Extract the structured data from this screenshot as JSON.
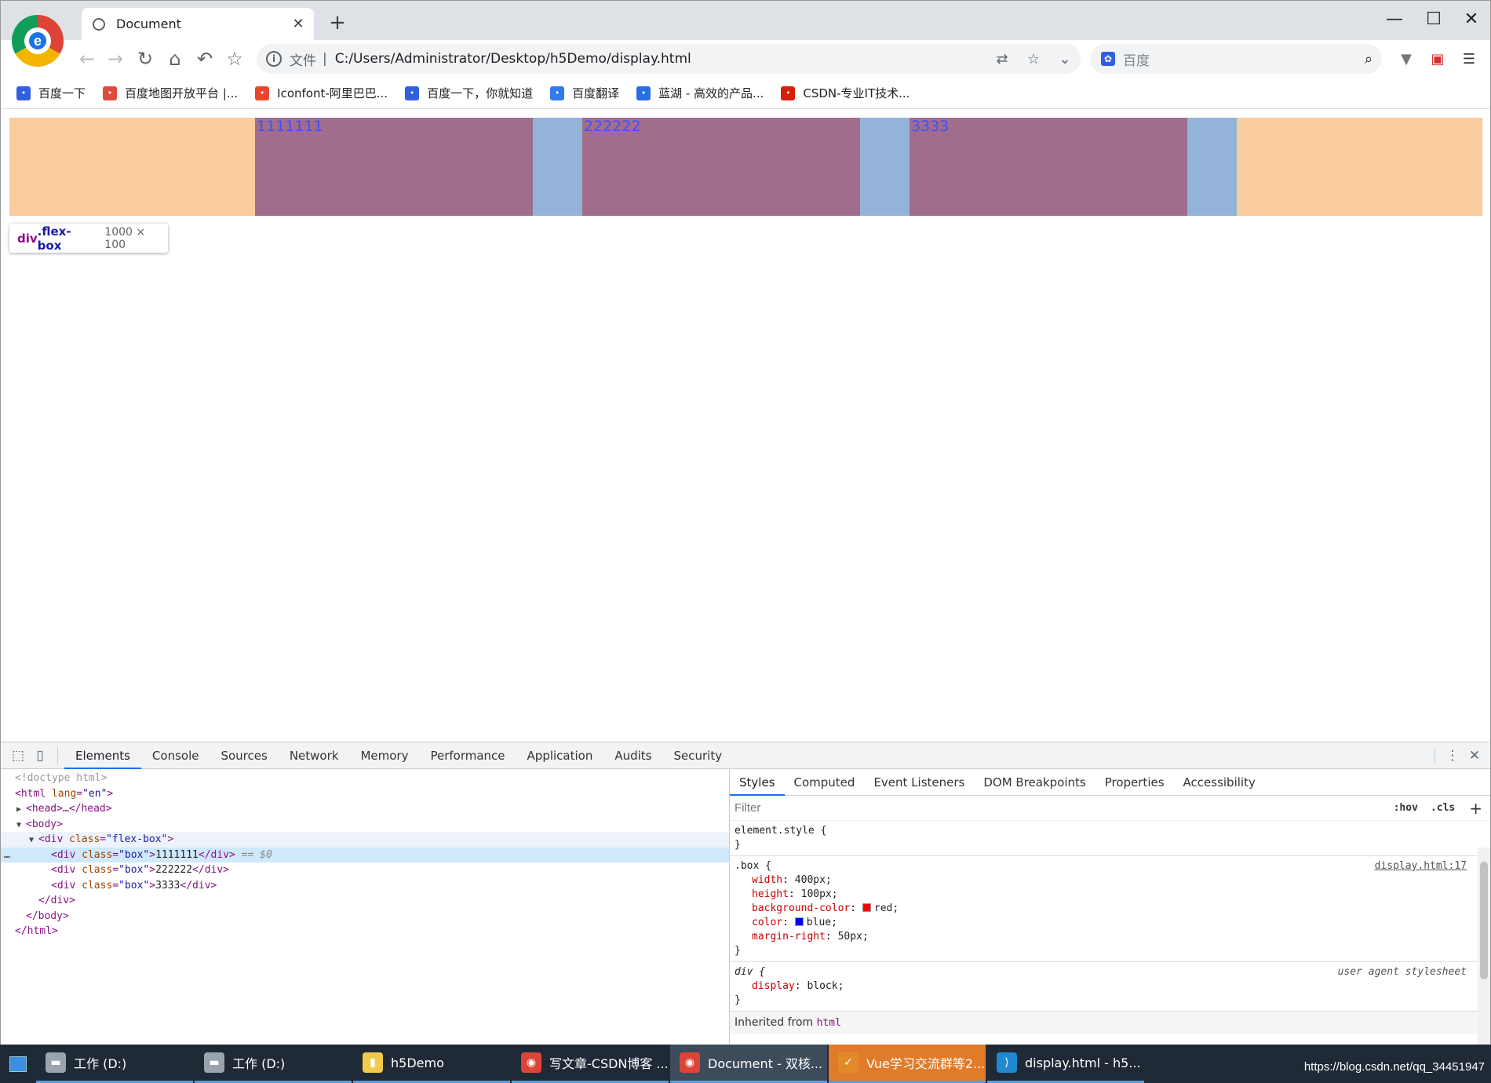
{
  "browser": {
    "tab_title": "Document",
    "omnibox_label": "文件",
    "omnibox_separator": "|",
    "url": "C:/Users/Administrator/Desktop/h5Demo/display.html",
    "search_placeholder": "百度"
  },
  "bookmarks": [
    {
      "label": "百度一下",
      "icon": "baidu-paw-icon",
      "color": "#3060e0"
    },
    {
      "label": "百度地图开放平台 |...",
      "icon": "map-pin-icon",
      "color": "#e04a3f"
    },
    {
      "label": "Iconfont-阿里巴巴...",
      "icon": "iconfont-icon",
      "color": "#e9462b"
    },
    {
      "label": "百度一下，你就知道",
      "icon": "baidu-paw-icon",
      "color": "#3060e0"
    },
    {
      "label": "百度翻译",
      "icon": "translate-icon",
      "color": "#2f7ce8"
    },
    {
      "label": "蓝湖 - 高效的产品...",
      "icon": "lanhu-icon",
      "color": "#2b6de6"
    },
    {
      "label": "CSDN-专业IT技术...",
      "icon": "csdn-icon",
      "color": "#d81e06"
    }
  ],
  "page": {
    "boxes": [
      "1111111",
      "222222",
      "3333"
    ],
    "tooltip": {
      "tag": "div",
      "class": ".flex-box",
      "size": "1000 × 100"
    }
  },
  "devtools": {
    "tabs": [
      "Elements",
      "Console",
      "Sources",
      "Network",
      "Memory",
      "Performance",
      "Application",
      "Audits",
      "Security"
    ],
    "active_tab": "Elements",
    "dom": {
      "doctype": "<!doctype html>",
      "html_open_tag": "html",
      "html_lang_attr": "lang",
      "html_lang_val": "\"en\"",
      "head_collapsed": "<head>…</head>",
      "body_open": "<body>",
      "flexbox_class": "\"flex-box\"",
      "box_class": "\"box\"",
      "box_texts": [
        "1111111",
        "222222",
        "3333"
      ],
      "selected_marker": "== $0",
      "div_close": "</div>",
      "body_close": "</body>",
      "html_close": "</html>"
    },
    "styles_tabs": [
      "Styles",
      "Computed",
      "Event Listeners",
      "DOM Breakpoints",
      "Properties",
      "Accessibility"
    ],
    "filter_placeholder": "Filter",
    "hov": ":hov",
    "cls": ".cls",
    "element_style": "element.style {",
    "box_rule": {
      "selector": ".box {",
      "source": "display.html:17",
      "props": [
        {
          "name": "width",
          "value": "400px;"
        },
        {
          "name": "height",
          "value": "100px;"
        },
        {
          "name": "background-color",
          "value": "red;",
          "swatch": "#ff0000"
        },
        {
          "name": "color",
          "value": "blue;",
          "swatch": "#0000ff"
        },
        {
          "name": "margin-right",
          "value": "50px;"
        }
      ]
    },
    "div_rule": {
      "selector": "div {",
      "source": "user agent stylesheet",
      "props": [
        {
          "name": "display",
          "value": "block;"
        }
      ]
    },
    "inherited_label": "Inherited from",
    "inherited_tag": "html"
  },
  "taskbar": {
    "items": [
      {
        "label": "工作 (D:)",
        "icon": "drive-icon"
      },
      {
        "label": "工作 (D:)",
        "icon": "drive-icon"
      },
      {
        "label": "h5Demo",
        "icon": "folder-icon"
      },
      {
        "label": "写文章-CSDN博客 ...",
        "icon": "chrome-icon"
      },
      {
        "label": "Document - 双核...",
        "icon": "chrome-icon"
      },
      {
        "label": "Vue学习交流群等2...",
        "icon": "qq-icon"
      },
      {
        "label": "display.html - h5...",
        "icon": "vscode-icon"
      }
    ],
    "credit": "https://blog.csdn.net/qq_34451947"
  },
  "colors": {
    "flex_padding": "#f9cc9d",
    "box_content": "#a16d8d",
    "box_margin": "#93b3d8",
    "box_text": "#3f4fff",
    "accent": "#1a73e8"
  }
}
